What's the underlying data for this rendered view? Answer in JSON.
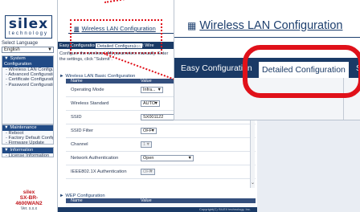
{
  "sidebar": {
    "logo_word": "silex",
    "logo_sub": "technology",
    "language_label": "Select Language",
    "language_value": "English",
    "nav": [
      {
        "title": "▼ System Configuration",
        "items": [
          "- Wireless LAN Configuration",
          "- Advanced Configuration",
          "- Certificate Configuration",
          "- Password Configuration"
        ]
      },
      {
        "title": "▼ Maintenance",
        "items": [
          "- Reboot",
          "- Factory Default Configuration",
          "- Firmware Update"
        ]
      },
      {
        "title": "▼ Information",
        "items": [
          "- License Information"
        ]
      }
    ],
    "product_brand": "silex",
    "product_model_1": "SX-BR-",
    "product_model_2": "4600WAN2",
    "product_version": "Ver. x.x.x"
  },
  "main": {
    "title": "Wireless LAN Configuration",
    "tabs": [
      "Easy Configuration",
      "Detailed Configuration",
      "Smart Wire"
    ],
    "instructions": "Configure the wireless LAN parameters manually. Enter the settings, click \"Submit\".",
    "section_basic": "► Wireless LAN Basic Configuration",
    "col_name": "Name",
    "col_value": "Value",
    "rows": [
      {
        "label": "Operating Mode",
        "value": "Infra..."
      },
      {
        "label": "Wireless Standard",
        "value": "AUTO"
      },
      {
        "label": "SSID",
        "value": "SX001122"
      },
      {
        "label": "SSID Filter",
        "value": "OFF"
      },
      {
        "label": "Channel",
        "value": "1"
      },
      {
        "label": "Network Authentication",
        "value": "Open"
      },
      {
        "label": "IEEE802.1X Authentication",
        "value": "OFF"
      }
    ],
    "section_wep": "► WEP Configuration",
    "footer": "Copyright(C) SILEX technology, Inc."
  },
  "zoom": {
    "title": "Wireless LAN Configuration",
    "tabs": [
      "Easy Configuration",
      "Detailed Configuration",
      "S"
    ]
  },
  "colors": {
    "accent": "#1a3a66",
    "highlight": "#e0111a",
    "product": "#c0151b"
  }
}
